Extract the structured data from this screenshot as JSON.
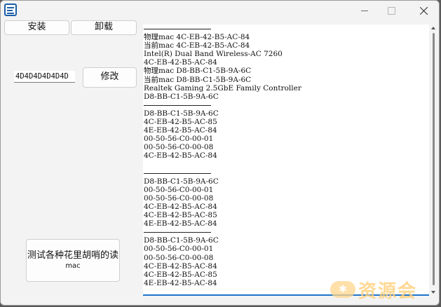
{
  "toolbar": {
    "install_label": "安装",
    "uninstall_label": "卸载",
    "modify_label": "修改",
    "test_label_line1": "测试各种花里胡哨的读",
    "test_label_line2": "mac"
  },
  "mac_input": {
    "value": "4D4D4D4D4D4D"
  },
  "log": {
    "lines": [
      "",
      "物理mac 4C-EB-42-B5-AC-84",
      "当前mac 4C-EB-42-B5-AC-84",
      "Intel(R) Dual Band Wireless-AC 7260",
      "4C-EB-42-B5-AC-84",
      "物理mac D8-BB-C1-5B-9A-6C",
      "当前mac D8-BB-C1-5B-9A-6C",
      "Realtek Gaming 2.5GbE Family Controller",
      "D8-BB-C1-5B-9A-6C",
      "",
      "D8-BB-C1-5B-9A-6C",
      "4C-EB-42-B5-AC-85",
      "4E-EB-42-B5-AC-84",
      "00-50-56-C0-00-01",
      "00-50-56-C0-00-08",
      "4C-EB-42-B5-AC-84",
      "",
      "",
      "D8-BB-C1-5B-9A-6C",
      "00-50-56-C0-00-01",
      "00-50-56-C0-00-08",
      "4C-EB-42-B5-AC-84",
      "4C-EB-42-B5-AC-85",
      "4E-EB-42-B5-AC-84",
      "",
      "D8-BB-C1-5B-9A-6C",
      "00-50-56-C0-00-01",
      "00-50-56-C0-00-08",
      "4C-EB-42-B5-AC-84",
      "4C-EB-42-B5-AC-85",
      "4E-EB-42-B5-AC-84"
    ],
    "separator_lines": [
      0,
      9,
      17,
      24
    ]
  },
  "watermark": {
    "text": "资源会",
    "logo": "logo-icon"
  },
  "icons": {
    "app": "app-icon",
    "minimize": "minimize-icon",
    "maximize": "maximize-icon",
    "close": "close-icon"
  },
  "colors": {
    "accent": "#1d74c8",
    "window_bg": "#f3f3f3"
  }
}
